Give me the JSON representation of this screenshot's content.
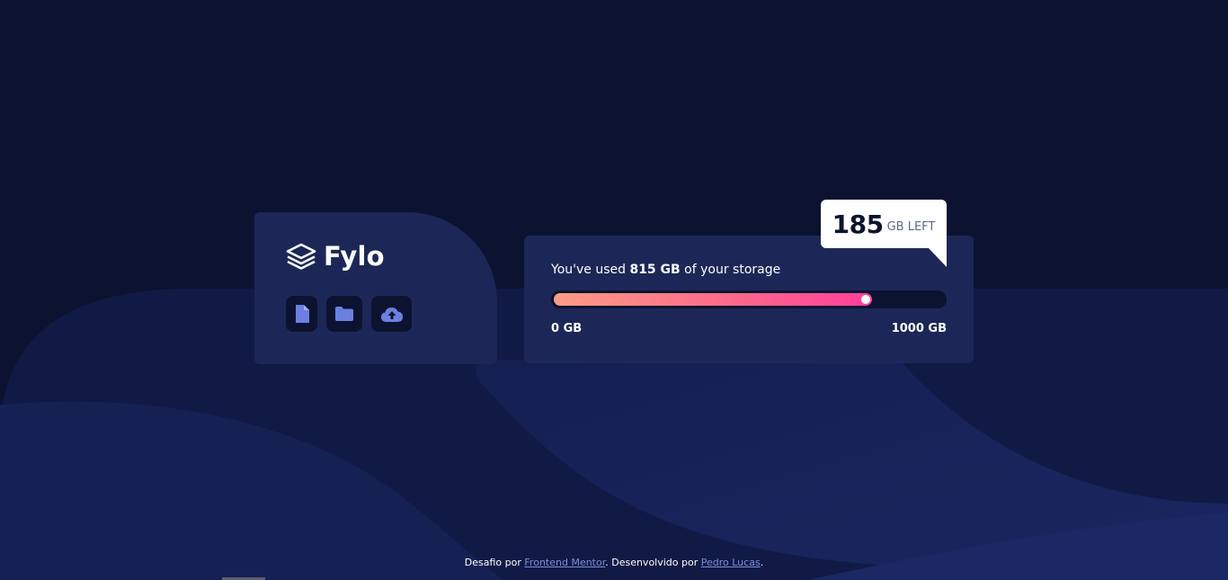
{
  "brand": {
    "name": "Fylo"
  },
  "actions": [
    {
      "icon": "file-icon"
    },
    {
      "icon": "folder-icon"
    },
    {
      "icon": "upload-icon"
    }
  ],
  "storage": {
    "used_prefix": "You've used",
    "used_amount": "815 GB",
    "used_suffix": "of your storage",
    "used_fraction": 0.815,
    "min_label": "0 GB",
    "max_label": "1000 GB",
    "remaining_value": "185",
    "remaining_label": "GB LEFT"
  },
  "footer": {
    "prefix": "Desafio por",
    "link1": "Frontend Mentor",
    "middle": ". Desenvolvido por",
    "link2": "Pedro Lucas",
    "suffix": "."
  },
  "colors": {
    "background": "#0c1330",
    "card": "#1c2758",
    "accent_start": "#fe9c85",
    "accent_end": "#ff3f9c",
    "icon": "#6c80e0"
  }
}
